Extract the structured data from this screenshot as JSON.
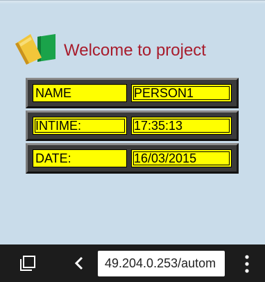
{
  "welcome": {
    "text": "Welcome to project"
  },
  "rows": [
    {
      "label": "NAME",
      "value": "PERSON1"
    },
    {
      "label": "INTIME:",
      "value": "17:35:13"
    },
    {
      "label": "DATE:",
      "value": "16/03/2015"
    }
  ],
  "browser_bar": {
    "url": "49.204.0.253/autom",
    "icons": [
      "tabs-icon",
      "back-icon",
      "menu-icon"
    ]
  },
  "colors": {
    "background": "#c9dcea",
    "welcome_text": "#a81c2c",
    "cell_fill": "#ffff00",
    "panel": "#3a3a3a",
    "navbar": "#1c1c1c"
  }
}
